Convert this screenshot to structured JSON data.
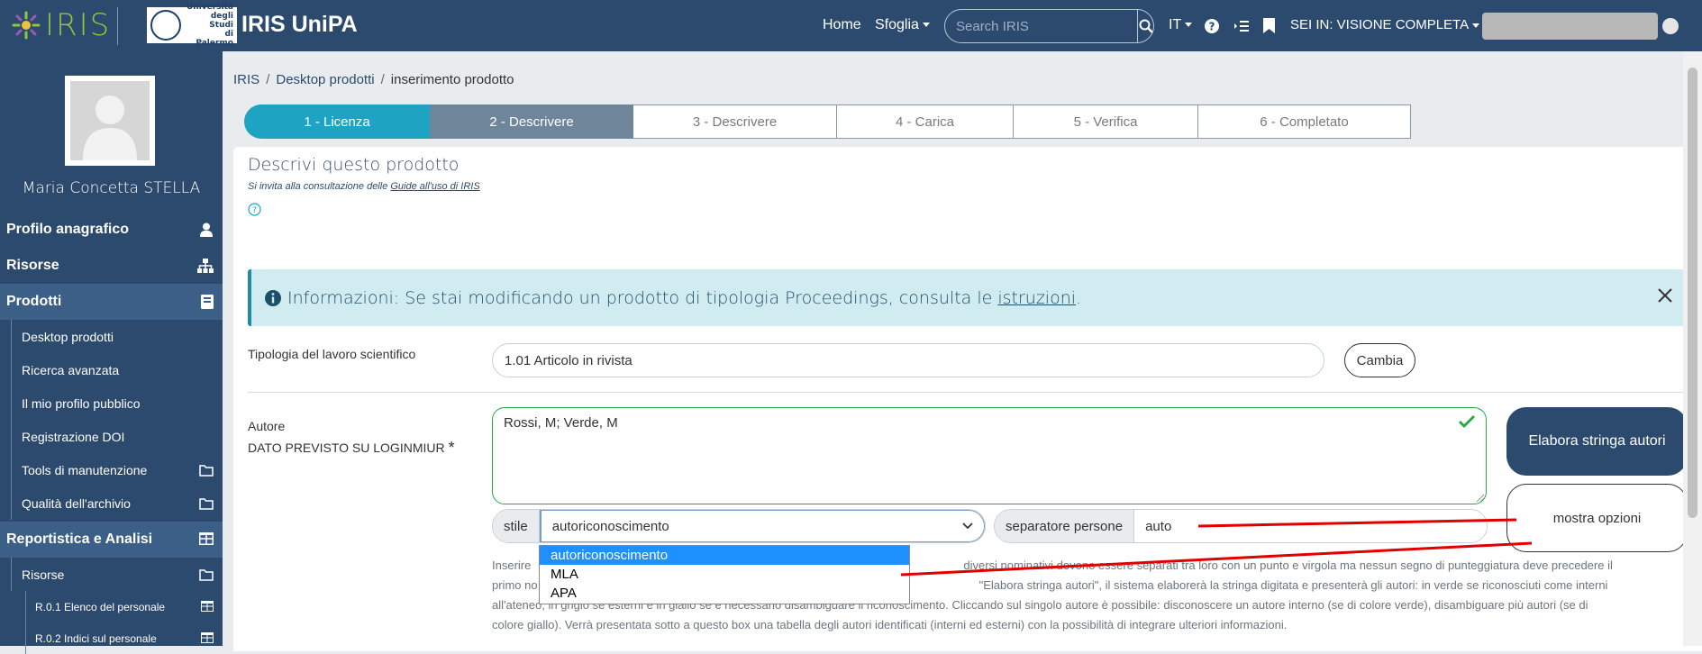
{
  "header": {
    "iris_logo_text": "IRIS",
    "university_logo_text": [
      "Università",
      "degli Studi",
      "di Palermo"
    ],
    "app_title": "IRIS UniPA",
    "nav": {
      "home": "Home",
      "browse": "Sfoglia",
      "language": "IT",
      "session": "SEI IN: VISIONE COMPLETA"
    },
    "search": {
      "placeholder": "Search IRIS"
    }
  },
  "sidebar": {
    "user_name": "Maria Concetta  STELLA",
    "sections": {
      "profile": "Profilo anagrafico",
      "resources": "Risorse",
      "products": "Prodotti",
      "reporting": "Reportistica e Analisi"
    },
    "product_items": [
      "Desktop prodotti",
      "Ricerca avanzata",
      "Il mio profilo pubblico",
      "Registrazione DOI",
      "Tools di manutenzione",
      "Qualità dell'archivio"
    ],
    "reporting_items": {
      "resources": "Risorse",
      "r01": "R.0.1 Elenco del personale",
      "r02": "R.0.2 Indici sul personale"
    }
  },
  "breadcrumb": [
    "IRIS",
    "Desktop prodotti",
    "inserimento prodotto"
  ],
  "steps": [
    "1 - Licenza",
    "2 - Descrivere",
    "3 - Descrivere",
    "4 - Carica",
    "5 - Verifica",
    "6 - Completato"
  ],
  "panel": {
    "title": "Descrivi questo prodotto",
    "hint_prefix": "Si invita alla consultazione delle ",
    "hint_link": "Guide all'uso di IRIS"
  },
  "alert": {
    "text": "Informazioni: Se stai modificando un prodotto di tipologia Proceedings, consulta le ",
    "link": "istruzioni",
    "suffix": "."
  },
  "typology": {
    "label": "Tipologia del lavoro scientifico",
    "value": "1.01 Articolo in rivista",
    "change_button": "Cambia"
  },
  "authors": {
    "label_line1": "Autore",
    "label_line2": "DATO PREVISTO SU LOGINMIUR",
    "required_mark": "*",
    "value": "Rossi, M; Verde, M",
    "process_button": "Elabora stringa autori",
    "options_button": "mostra opzioni",
    "style_label": "stile",
    "style_value": "autoriconoscimento",
    "style_options": [
      "autoriconoscimento",
      "MLA",
      "APA"
    ],
    "separator_label": "separatore persone",
    "separator_value": "auto",
    "help_text_1": "Inserire",
    "help_text_2": "diversi nominativi devono essere separati tra loro con un punto e virgola ma nessun segno di punteggiatura deve precedere il",
    "help_text_3": "primo no",
    "help_text_4": "\"Elabora stringa autori\", il sistema elaborerà la stringa digitata e presenterà gli autori: in verde se riconosciuti come interni",
    "help_text_5": "all'ateneo, in grigio se esterni e in giallo se è necessario disambiguare il riconoscimento. Cliccando sul singolo autore è possibile: disconoscere un autore interno (se di colore verde), disambiguare più autori (se di",
    "help_text_6": "colore giallo). Verrà presentata sotto a questo box una tabella degli autori identificati (interni ed esterni) con la possibilità di integrare ulteriori informazioni."
  },
  "colors": {
    "navbar": "#2c4a6e",
    "step_active": "#1fa3c2",
    "step_current": "#6f8599",
    "alert_bg": "#d1ecf1",
    "valid_green": "#28a745",
    "annotation_red": "#e00000"
  }
}
